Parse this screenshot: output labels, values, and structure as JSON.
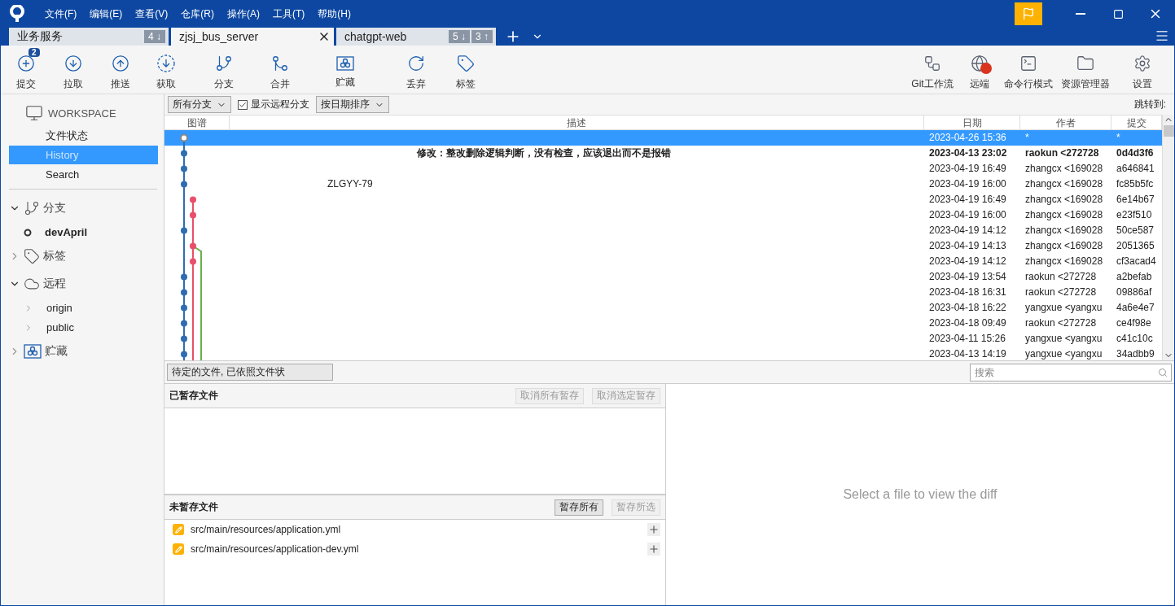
{
  "menu": [
    "文件(F)",
    "编辑(E)",
    "查看(V)",
    "仓库(R)",
    "操作(A)",
    "工具(T)",
    "帮助(H)"
  ],
  "tabs": [
    {
      "label": "业务服务",
      "selected": false,
      "badges": [
        "4 ↓"
      ]
    },
    {
      "label": "zjsj_bus_server",
      "selected": true
    },
    {
      "label": "chatgpt-web",
      "selected": false,
      "badges": [
        "5 ↓",
        "3 ↑"
      ]
    }
  ],
  "toolbar_left": [
    {
      "label": "提交",
      "badge": "2"
    },
    {
      "label": "拉取"
    },
    {
      "label": "推送"
    },
    {
      "label": "获取"
    },
    {
      "label": "分支"
    },
    {
      "label": "合并"
    },
    {
      "label": "贮藏"
    },
    {
      "label": "丢弃"
    },
    {
      "label": "标签"
    }
  ],
  "toolbar_right": [
    {
      "label": "Git工作流",
      "alert": false
    },
    {
      "label": "远端",
      "alert": true
    },
    {
      "label": "命令行模式",
      "alert": false
    },
    {
      "label": "资源管理器",
      "alert": false
    },
    {
      "label": "设置",
      "alert": false
    }
  ],
  "sidebar": {
    "workspace": "WORKSPACE",
    "workspace_items": [
      {
        "label": "文件状态",
        "selected": false
      },
      {
        "label": "History",
        "selected": true
      },
      {
        "label": "Search",
        "selected": false
      }
    ],
    "sections": [
      {
        "label": "分支",
        "expanded": true,
        "children": [
          {
            "label": "devApril",
            "current": true
          }
        ]
      },
      {
        "label": "标签",
        "expanded": false
      },
      {
        "label": "远程",
        "expanded": true,
        "children": [
          {
            "label": "origin",
            "current": false
          },
          {
            "label": "public",
            "current": false
          }
        ]
      },
      {
        "label": "贮藏",
        "expanded": false
      }
    ]
  },
  "filter_bar": {
    "branches": "所有分支",
    "show_remote": {
      "label": "显示远程分支",
      "checked": true
    },
    "sort": "按日期排序",
    "jump_to": "跳转到:"
  },
  "table": {
    "columns": [
      "图谱",
      "描述",
      "日期",
      "作者",
      "提交"
    ],
    "rows": [
      {
        "kind": "uncommitted",
        "color": "#888888",
        "selected": true,
        "current": false,
        "description": "",
        "date": "2023-04-26 15:36",
        "author": "*",
        "commit": "*"
      },
      {
        "kind": "commit",
        "color": "#2f6db0",
        "selected": false,
        "current": true,
        "description": "修改：整改删除逻辑判断，没有检查，应该退出而不是报错",
        "date": "2023-04-13 23:02",
        "author": "raokun <272728",
        "commit": "0d4d3f6"
      },
      {
        "kind": "commit",
        "color": "#2f6db0",
        "selected": false,
        "current": false,
        "description": "",
        "date": "2023-04-19 16:49",
        "author": "zhangcx <169028",
        "commit": "a646841"
      },
      {
        "kind": "commit",
        "color": "#2f6db0",
        "selected": false,
        "current": false,
        "description": "ZLGYY-79",
        "date": "2023-04-19 16:00",
        "author": "zhangcx <169028",
        "commit": "fc85b5fc"
      },
      {
        "kind": "commit",
        "color": "#e8506a",
        "selected": false,
        "current": false,
        "description": "",
        "date": "2023-04-19 16:49",
        "author": "zhangcx <169028",
        "commit": "6e14b67"
      },
      {
        "kind": "commit",
        "color": "#e8506a",
        "selected": false,
        "current": false,
        "description": "",
        "date": "2023-04-19 16:00",
        "author": "zhangcx <169028",
        "commit": "e23f510"
      },
      {
        "kind": "commit",
        "color": "#2f6db0",
        "selected": false,
        "current": false,
        "description": "",
        "date": "2023-04-19 14:12",
        "author": "zhangcx <169028",
        "commit": "50ce587"
      },
      {
        "kind": "commit",
        "color": "#e8506a",
        "selected": false,
        "current": false,
        "description": "",
        "date": "2023-04-19 14:13",
        "author": "zhangcx <169028",
        "commit": "2051365"
      },
      {
        "kind": "commit",
        "color": "#e8506a",
        "selected": false,
        "current": false,
        "description": "",
        "date": "2023-04-19 14:12",
        "author": "zhangcx <169028",
        "commit": "cf3acad4"
      },
      {
        "kind": "commit",
        "color": "#2f6db0",
        "selected": false,
        "current": false,
        "description": "",
        "date": "2023-04-19 13:54",
        "author": "raokun <272728",
        "commit": "a2befab"
      },
      {
        "kind": "commit",
        "color": "#2f6db0",
        "selected": false,
        "current": false,
        "description": "",
        "date": "2023-04-18 16:31",
        "author": "raokun <272728",
        "commit": "09886af"
      },
      {
        "kind": "commit",
        "color": "#2f6db0",
        "selected": false,
        "current": false,
        "description": "",
        "date": "2023-04-18 16:22",
        "author": "yangxue <yangxu",
        "commit": "4a6e4e7"
      },
      {
        "kind": "commit",
        "color": "#2f6db0",
        "selected": false,
        "current": false,
        "description": "",
        "date": "2023-04-18 09:49",
        "author": "raokun <272728",
        "commit": "ce4f98e"
      },
      {
        "kind": "commit",
        "color": "#2f6db0",
        "selected": false,
        "current": false,
        "description": "",
        "date": "2023-04-11 15:26",
        "author": "yangxue <yangxu",
        "commit": "c41c10c"
      },
      {
        "kind": "commit",
        "color": "#2f6db0",
        "selected": false,
        "current": false,
        "description": "",
        "date": "2023-04-13 14:19",
        "author": "yangxue <yangxu",
        "commit": "34adbb9"
      }
    ]
  },
  "pending": {
    "sort": "待定的文件, 已依照文件状",
    "search": {
      "placeholder": "搜索"
    }
  },
  "staged": {
    "title": "已暂存文件",
    "buttons": [
      {
        "label": "取消所有暂存",
        "disabled": true
      },
      {
        "label": "取消选定暂存",
        "disabled": true
      }
    ]
  },
  "unstaged": {
    "title": "未暂存文件",
    "buttons": [
      {
        "label": "暂存所有",
        "disabled": false
      },
      {
        "label": "暂存所选",
        "disabled": true
      }
    ],
    "files": [
      "src/main/resources/application.yml",
      "src/main/resources/application-dev.yml"
    ]
  },
  "diff": {
    "message": "Select a file to view the diff"
  }
}
